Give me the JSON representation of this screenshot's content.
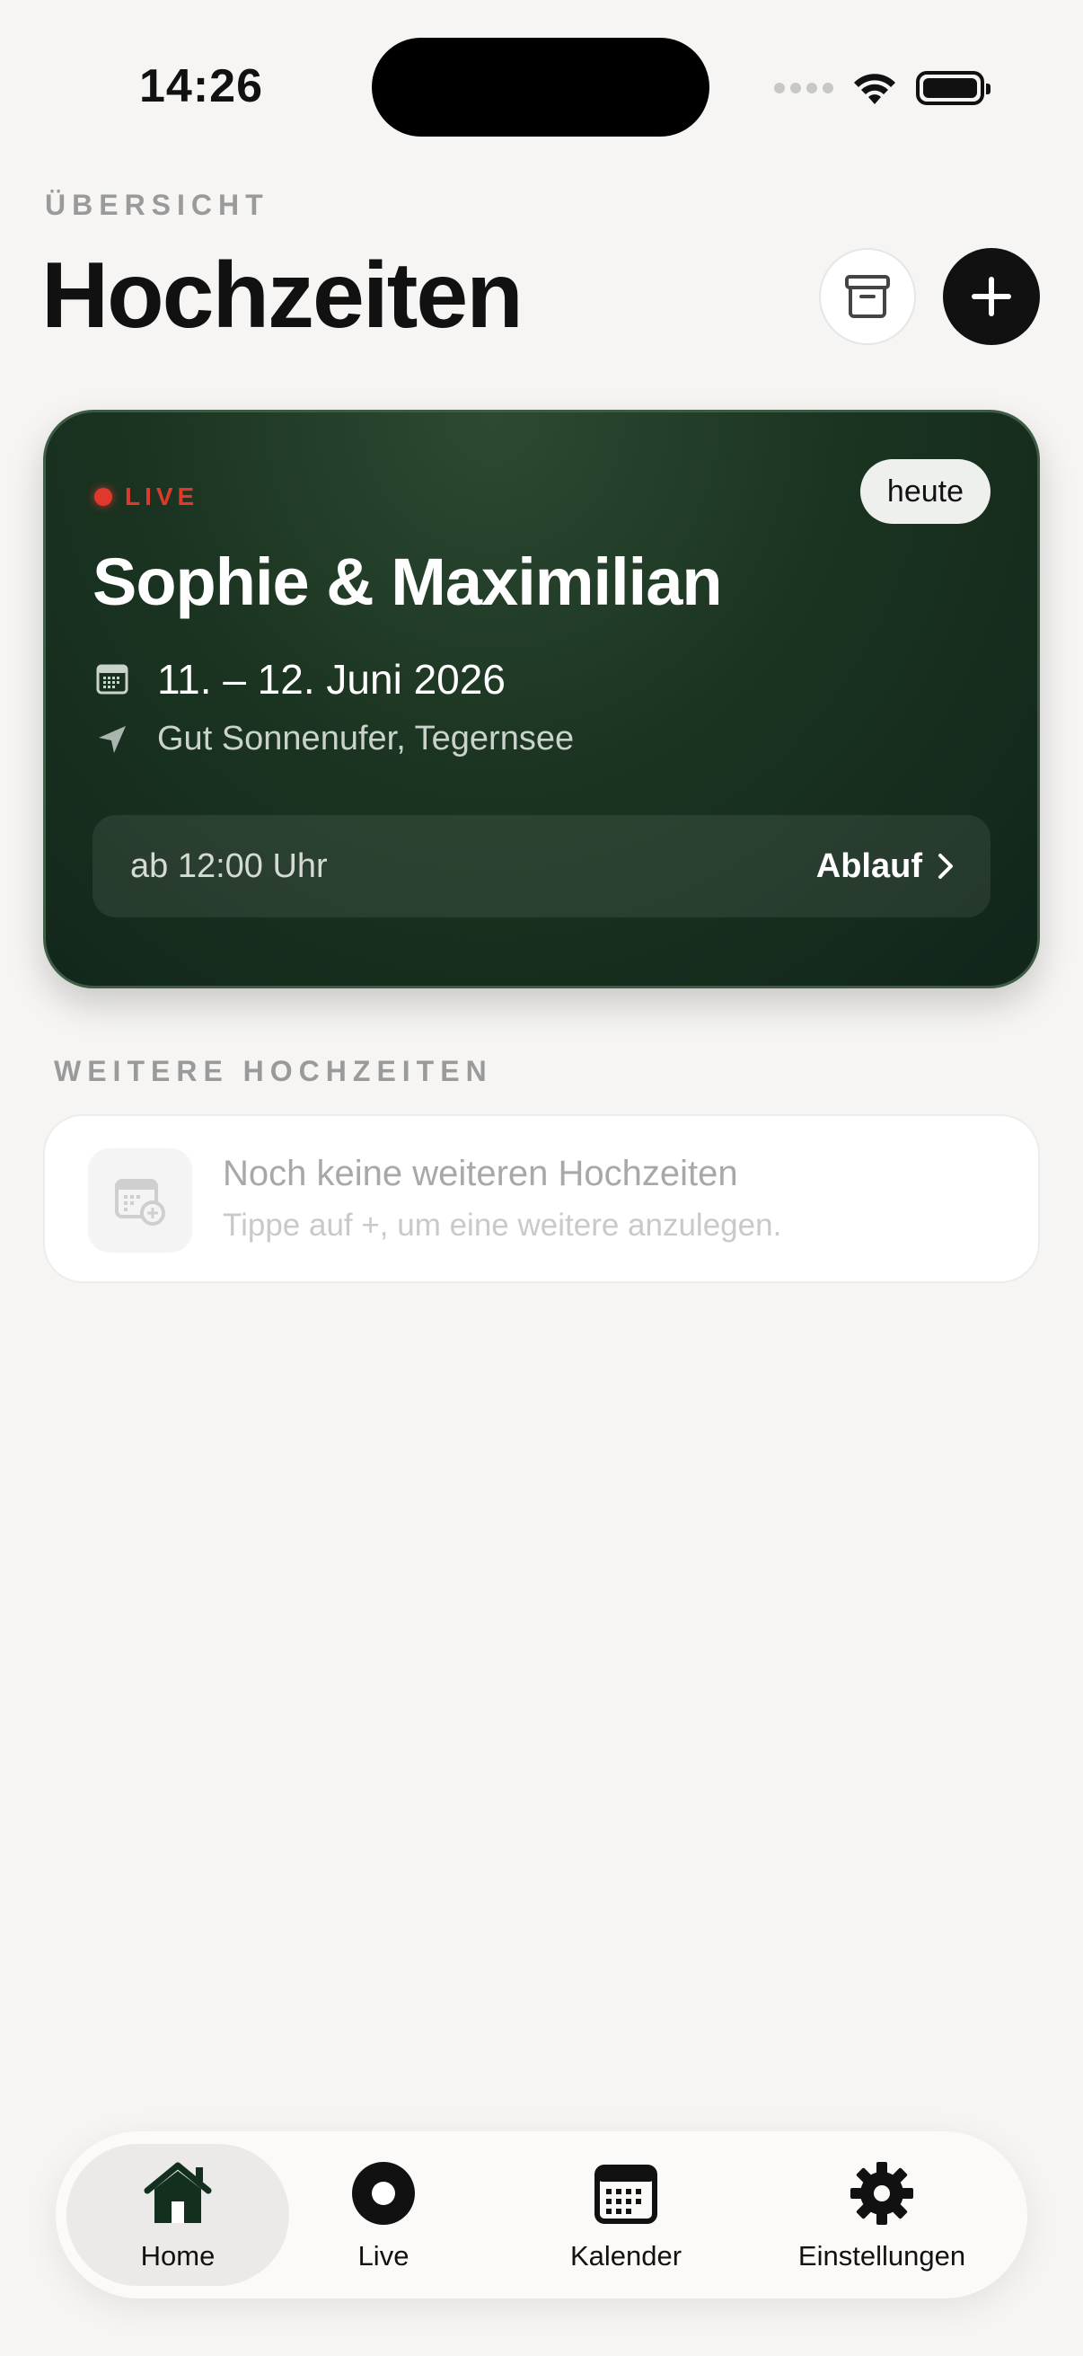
{
  "status_bar": {
    "time": "14:26"
  },
  "header": {
    "eyebrow": "ÜBERSICHT",
    "title": "Hochzeiten"
  },
  "live_wedding": {
    "live_label": "LIVE",
    "badge": "heute",
    "couple": "Sophie & Maximilian",
    "date": "11. – 12. Juni 2026",
    "location": "Gut Sonnenufer, Tegernsee",
    "schedule_time": "ab 12:00 Uhr",
    "schedule_link": "Ablauf"
  },
  "more_weddings": {
    "section_label": "WEITERE HOCHZEITEN",
    "empty_title": "Noch keine weiteren Hochzeiten",
    "empty_subtitle": "Tippe auf +, um eine weitere anzulegen."
  },
  "tab_bar": {
    "home": "Home",
    "live": "Live",
    "calendar": "Kalender",
    "settings": "Einstellungen",
    "active": "home"
  },
  "colors": {
    "background": "#f6f5f3",
    "card_green": "#1b3421",
    "live_red": "#e0382b",
    "home_icon_green": "#12301d"
  },
  "icons": {
    "archive": "archive-box-icon",
    "add": "plus-icon",
    "calendar": "calendar-icon",
    "location": "location-arrow-icon",
    "chevron": "chevron-right-icon",
    "home": "house-icon",
    "live": "record-circle-icon",
    "settings": "gear-icon"
  }
}
